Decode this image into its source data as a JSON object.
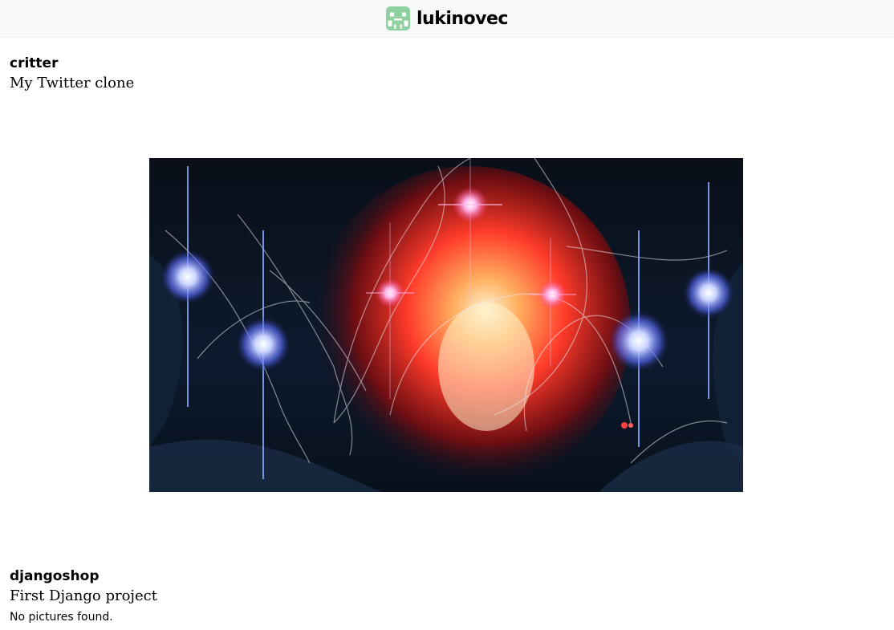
{
  "header": {
    "site_name": "lukinovec",
    "logo_icon": "alien-invader-icon",
    "logo_color": "#8fd19e",
    "background": "#f7f8fa"
  },
  "projects": [
    {
      "title": "critter",
      "description": "My Twitter clone",
      "image": {
        "icon": "project-screenshot-image",
        "palette": {
          "background": "#0b1220",
          "glow_red": "#ff3b2a",
          "glow_orange": "#ffb060",
          "spark_blue": "#8fa8ff"
        }
      }
    },
    {
      "title": "djangoshop",
      "description": "First Django project",
      "note": "No pictures found."
    }
  ]
}
